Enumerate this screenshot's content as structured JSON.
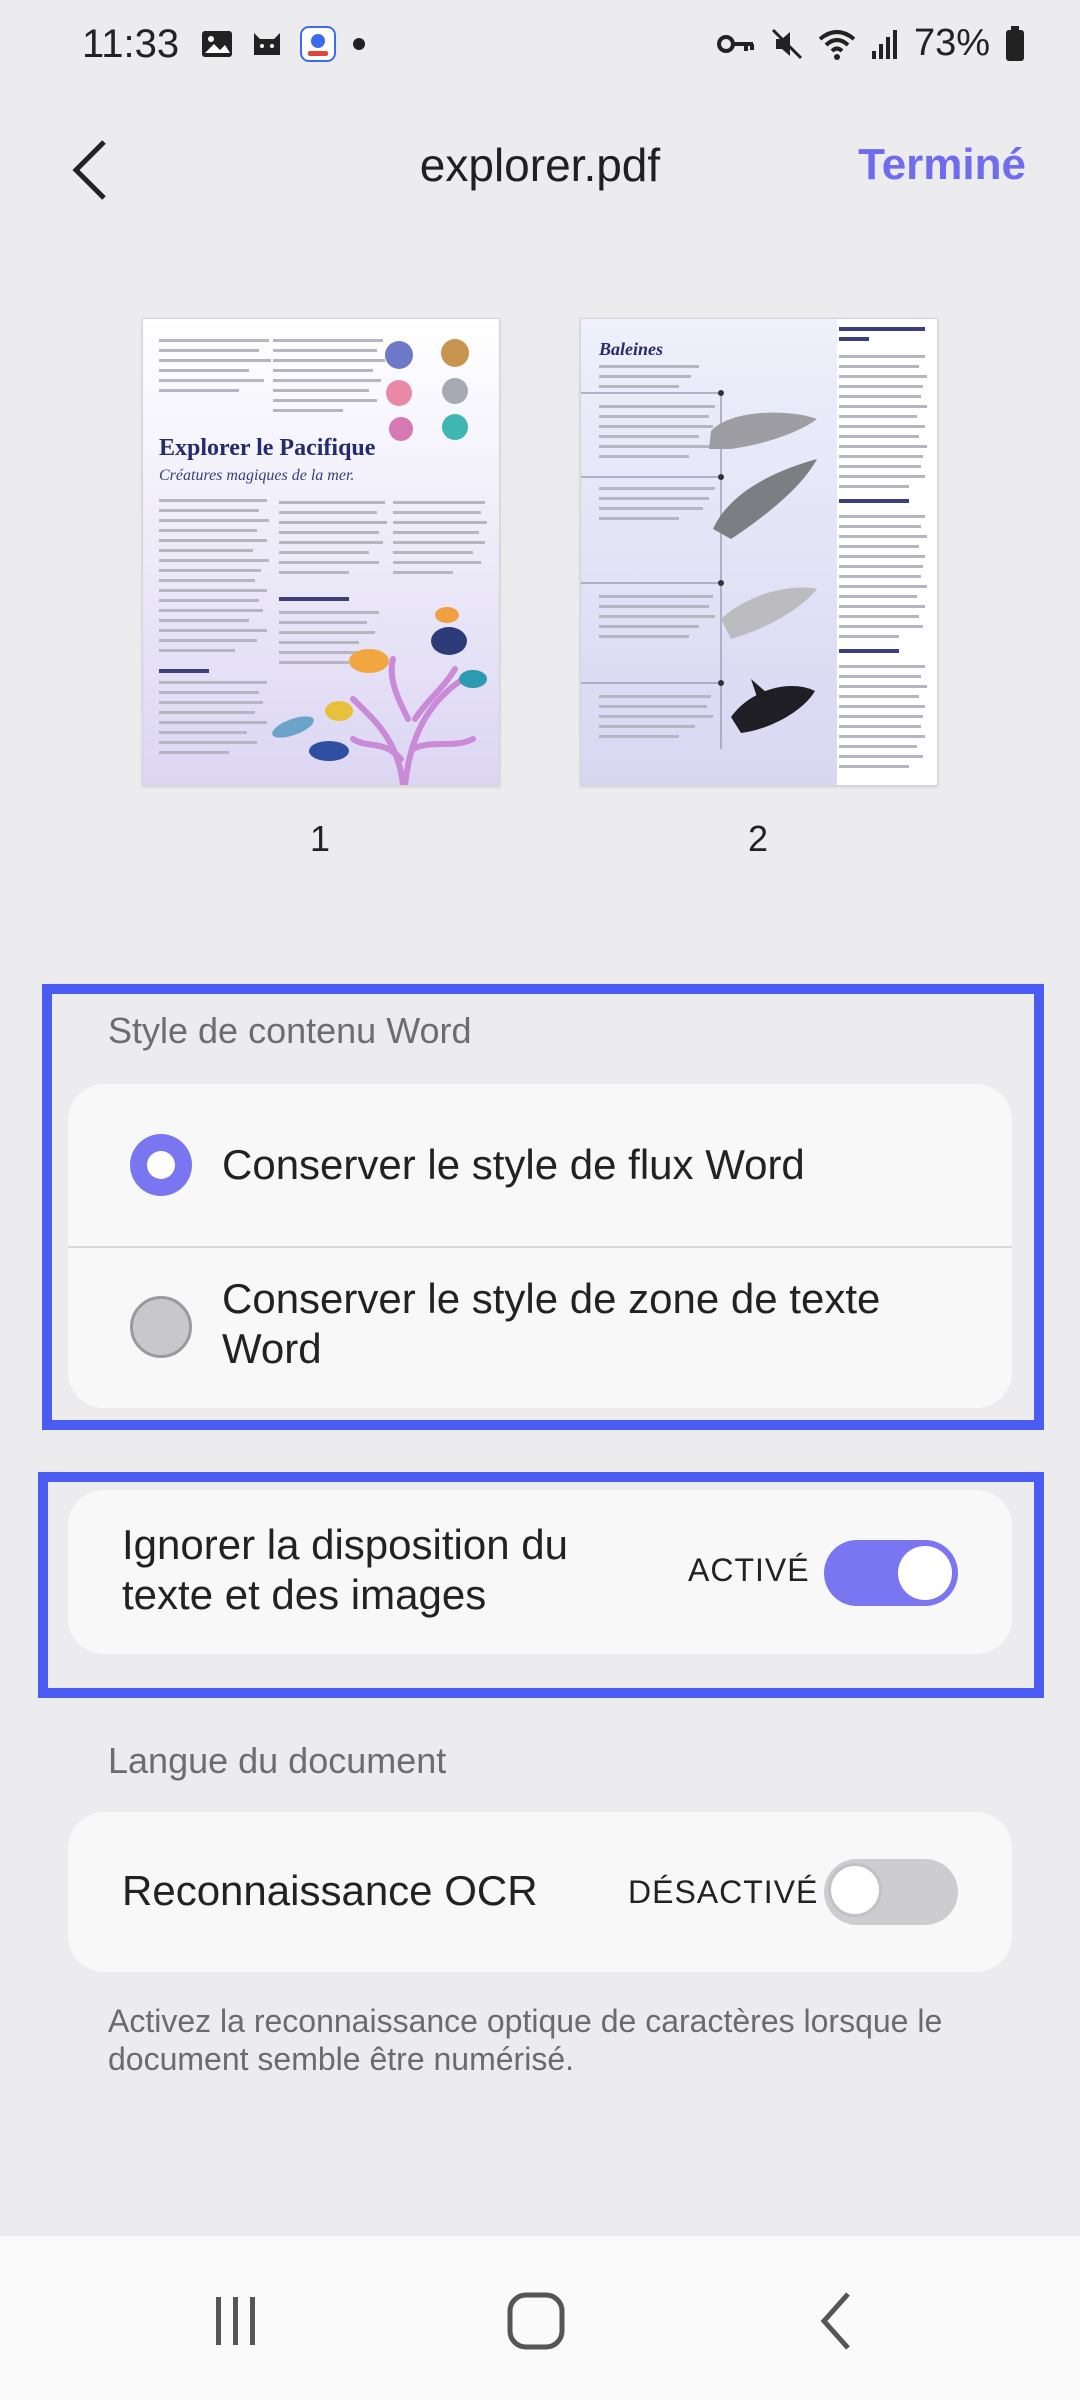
{
  "status_bar": {
    "time": "11:33",
    "battery": "73%",
    "icons": [
      "image-icon",
      "cat-icon",
      "app-badge-icon",
      "dot-icon",
      "key-icon",
      "mute-icon",
      "wifi-icon",
      "signal-icon",
      "battery-icon"
    ]
  },
  "header": {
    "back_icon": "chevron-left-icon",
    "title": "explorer.pdf",
    "done_label": "Terminé"
  },
  "pages": [
    {
      "number": "1",
      "title": "Explorer le Pacifique",
      "subtitle": "Créatures magiques de la mer."
    },
    {
      "number": "2",
      "title": "Baleines"
    }
  ],
  "content_style": {
    "label": "Style de contenu Word",
    "options": [
      {
        "label": "Conserver le style de flux Word",
        "selected": true
      },
      {
        "label": "Conserver le style de zone de texte Word",
        "selected": false
      }
    ]
  },
  "ignore_layout": {
    "label": "Ignorer la disposition du texte et des images",
    "state_label": "ACTIVÉ",
    "enabled": true
  },
  "document_language": {
    "label": "Langue du document",
    "ocr_label": "Reconnaissance OCR",
    "state_label": "DÉSACTIVÉ",
    "enabled": false,
    "help_text": "Activez la reconnaissance optique de caractères lorsque le document semble être numérisé."
  },
  "colors": {
    "accent": "#7a76f2",
    "highlight": "#4a5cf2",
    "background": "#ececee"
  },
  "nav": {
    "icons": [
      "recent-apps-icon",
      "home-icon",
      "back-icon"
    ]
  }
}
